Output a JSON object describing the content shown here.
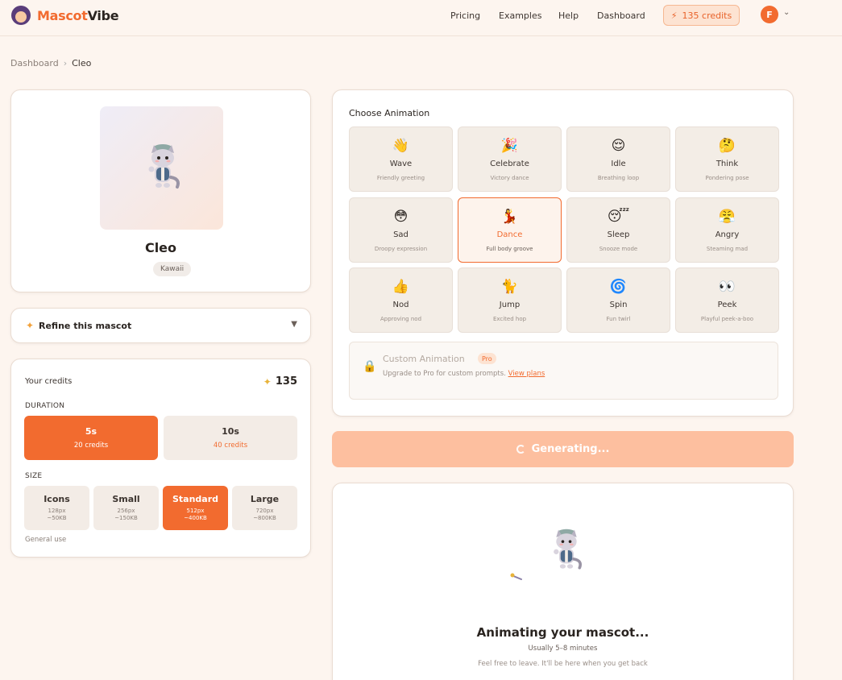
{
  "header": {
    "brand_part1": "Mascot",
    "brand_part2": "Vibe",
    "nav": [
      "Pricing",
      "Examples",
      "Help",
      "Dashboard"
    ],
    "credits_label": "135 credits",
    "avatar_initial": "F"
  },
  "breadcrumb": {
    "parent": "Dashboard",
    "separator": "›",
    "current": "Cleo"
  },
  "mascot": {
    "name": "Cleo",
    "style_tag": "Kawaii"
  },
  "refine": {
    "label": "Refine this mascot"
  },
  "credits": {
    "title": "Your credits",
    "value": "135",
    "duration_label": "DURATION",
    "durations": [
      {
        "label": "5s",
        "cost": "20 credits",
        "selected": true
      },
      {
        "label": "10s",
        "cost": "40 credits",
        "selected": false
      }
    ],
    "size_label": "SIZE",
    "sizes": [
      {
        "label": "Icons",
        "px": "128px",
        "kb": "~50KB",
        "selected": false
      },
      {
        "label": "Small",
        "px": "256px",
        "kb": "~150KB",
        "selected": false
      },
      {
        "label": "Standard",
        "px": "512px",
        "kb": "~400KB",
        "selected": true
      },
      {
        "label": "Large",
        "px": "720px",
        "kb": "~800KB",
        "selected": false
      }
    ],
    "size_help": "General use"
  },
  "animation": {
    "title": "Choose Animation",
    "options": [
      {
        "label": "Wave",
        "desc": "Friendly greeting",
        "emoji": "👋",
        "icon": "waving-hand-icon",
        "selected": false
      },
      {
        "label": "Celebrate",
        "desc": "Victory dance",
        "emoji": "🎉",
        "icon": "party-popper-icon",
        "selected": false
      },
      {
        "label": "Idle",
        "desc": "Breathing loop",
        "emoji": "😌",
        "icon": "relieved-face-icon",
        "selected": false
      },
      {
        "label": "Think",
        "desc": "Pondering pose",
        "emoji": "🤔",
        "icon": "thinking-face-icon",
        "selected": false
      },
      {
        "label": "Sad",
        "desc": "Droopy expression",
        "emoji": "😳",
        "icon": "flushed-face-icon",
        "selected": false
      },
      {
        "label": "Dance",
        "desc": "Full body groove",
        "emoji": "💃",
        "icon": "dancer-icon",
        "selected": true
      },
      {
        "label": "Sleep",
        "desc": "Snooze mode",
        "emoji": "😴",
        "icon": "sleeping-face-icon",
        "selected": false
      },
      {
        "label": "Angry",
        "desc": "Steaming mad",
        "emoji": "😤",
        "icon": "steaming-face-icon",
        "selected": false
      },
      {
        "label": "Nod",
        "desc": "Approving nod",
        "emoji": "👍",
        "icon": "thumbs-up-icon",
        "selected": false
      },
      {
        "label": "Jump",
        "desc": "Excited hop",
        "emoji": "🐈",
        "icon": "cat-icon",
        "selected": false
      },
      {
        "label": "Spin",
        "desc": "Fun twirl",
        "emoji": "🌀",
        "icon": "cyclone-icon",
        "selected": false
      },
      {
        "label": "Peek",
        "desc": "Playful peek-a-boo",
        "emoji": "👀",
        "icon": "eyes-icon",
        "selected": false
      }
    ],
    "custom": {
      "title": "Custom Animation",
      "badge": "Pro",
      "desc": "Upgrade to Pro for custom prompts.",
      "link": "View plans"
    }
  },
  "generate": {
    "label": "Generating..."
  },
  "progress": {
    "title": "Animating your mascot...",
    "subtitle": "Usually 5–8 minutes",
    "note": "Feel free to leave. It'll be here when you get back"
  },
  "colors": {
    "accent": "#f26b2f",
    "background": "#fdf5ef",
    "tile": "#f3ede6",
    "generating": "#fdbf9f"
  }
}
